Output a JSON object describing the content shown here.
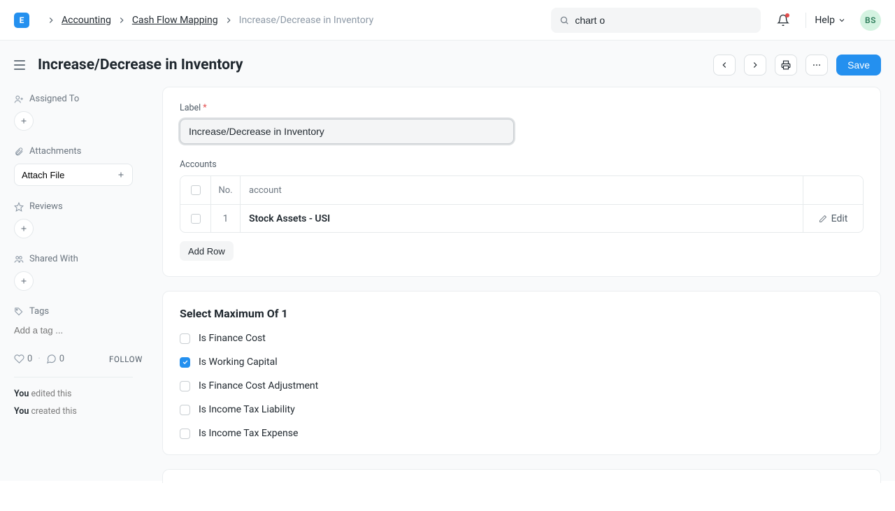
{
  "logo": "E",
  "breadcrumb": {
    "items": [
      "Accounting",
      "Cash Flow Mapping",
      "Increase/Decrease in Inventory"
    ]
  },
  "search": {
    "value": "chart o"
  },
  "help_label": "Help",
  "avatar_initials": "BS",
  "page_title": "Increase/Decrease in Inventory",
  "toolbar": {
    "save_label": "Save"
  },
  "sidebar": {
    "assigned_label": "Assigned To",
    "attachments_label": "Attachments",
    "attach_btn_label": "Attach File",
    "reviews_label": "Reviews",
    "shared_with_label": "Shared With",
    "tags_label": "Tags",
    "tags_placeholder": "Add a tag ...",
    "likes": "0",
    "comments": "0",
    "follow_label": "FOLLOW",
    "audit": {
      "edited_prefix": "You",
      "edited_suffix": " edited this",
      "created_prefix": "You",
      "created_suffix": " created this"
    }
  },
  "form": {
    "label_caption": "Label",
    "label_value": "Increase/Decrease in Inventory",
    "accounts_caption": "Accounts",
    "table": {
      "col_no": "No.",
      "col_account": "account",
      "rows": [
        {
          "no": "1",
          "account": "Stock Assets - USI"
        }
      ],
      "edit_label": "Edit",
      "add_row_label": "Add Row"
    },
    "checkgroup": {
      "heading": "Select Maximum Of 1",
      "options": [
        {
          "label": "Is Finance Cost",
          "checked": false
        },
        {
          "label": "Is Working Capital",
          "checked": true
        },
        {
          "label": "Is Finance Cost Adjustment",
          "checked": false
        },
        {
          "label": "Is Income Tax Liability",
          "checked": false
        },
        {
          "label": "Is Income Tax Expense",
          "checked": false
        }
      ]
    }
  }
}
